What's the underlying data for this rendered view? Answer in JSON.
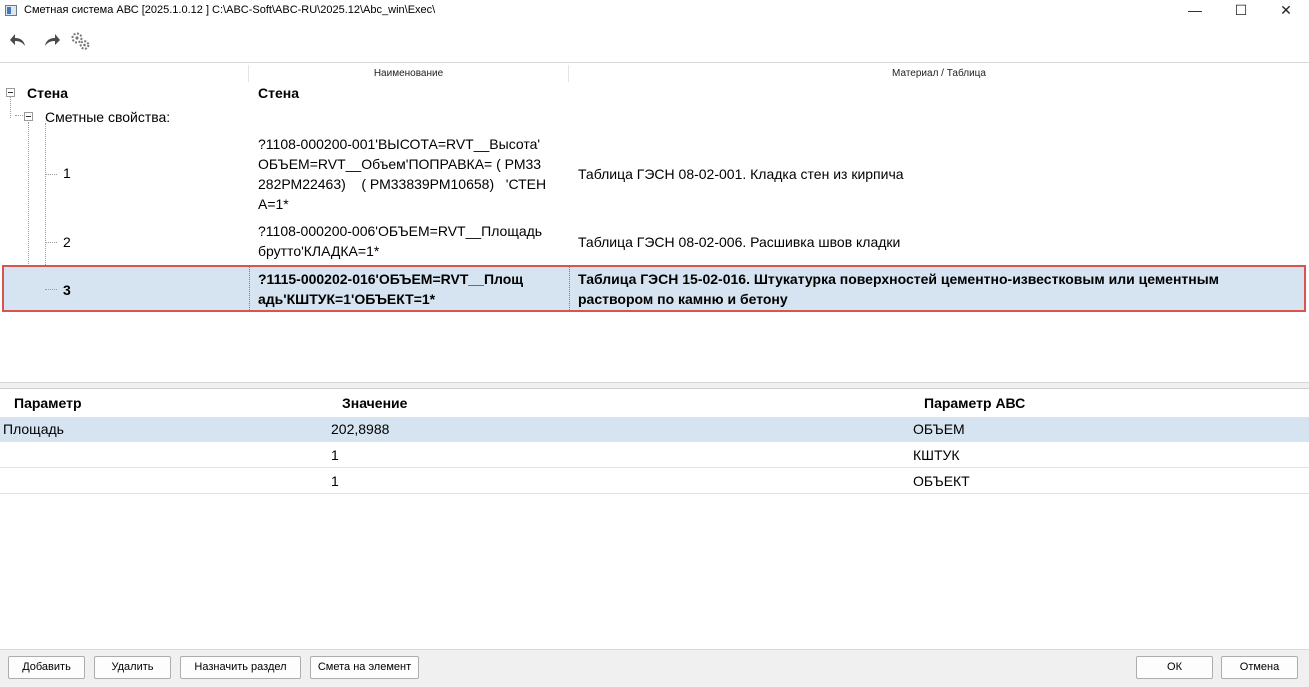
{
  "window": {
    "title": "Сметная система АВС [2025.1.0.12 ]   C:\\ABC-Soft\\ABC-RU\\2025.12\\Abc_win\\Exec\\",
    "minimize": "—",
    "maximize": "☐",
    "close": "✕"
  },
  "toolbar": {
    "undo_icon": "undo-icon",
    "redo_icon": "redo-icon",
    "settings_icon": "gears-icon"
  },
  "tree": {
    "columns": [
      "Наименование",
      "Материал / Таблица"
    ],
    "root": {
      "label": "Стена",
      "name": "Стена"
    },
    "group": {
      "label": "Сметные свойства:"
    },
    "items": [
      {
        "num": "1",
        "name_lines": [
          "?1108-000200-001'ВЫСОТА=RVT__Высота'",
          "ОБЪЕМ=RVT__Объем'ПОПРАВКА= ( РМ33",
          "282РМ22463)    ( РМ33839РМ10658)   'СТЕН",
          "А=1*"
        ],
        "material": "Таблица ГЭСН 08-02-001. Кладка стен из кирпича"
      },
      {
        "num": "2",
        "name_lines": [
          "?1108-000200-006'ОБЪЕМ=RVT__Площадь",
          "брутто'КЛАДКА=1*"
        ],
        "material": "Таблица ГЭСН 08-02-006. Расшивка швов кладки"
      },
      {
        "num": "3",
        "name_lines": [
          "?1115-000202-016'ОБЪЕМ=RVT__Площ",
          "адь'КШТУК=1'ОБЪЕКТ=1*"
        ],
        "material_lines": [
          "Таблица ГЭСН 15-02-016. Штукатурка поверхностей цементно-известковым или цементным",
          "раствором по камню и бетону"
        ]
      }
    ]
  },
  "params": {
    "headers": [
      "Параметр",
      "Значение",
      "Параметр АВС"
    ],
    "rows": [
      [
        "Площадь",
        "202,8988",
        "ОБЪЕМ"
      ],
      [
        "",
        "1",
        "КШТУК"
      ],
      [
        "",
        "1",
        "ОБЪЕКТ"
      ]
    ]
  },
  "buttons": {
    "add": "Добавить",
    "delete": "Удалить",
    "assign_section": "Назначить раздел",
    "estimate_element": "Смета на элемент",
    "ok": "ОК",
    "cancel": "Отмена"
  },
  "colors": {
    "selection": "#d6e3f0",
    "highlight_border": "#d9534f"
  }
}
